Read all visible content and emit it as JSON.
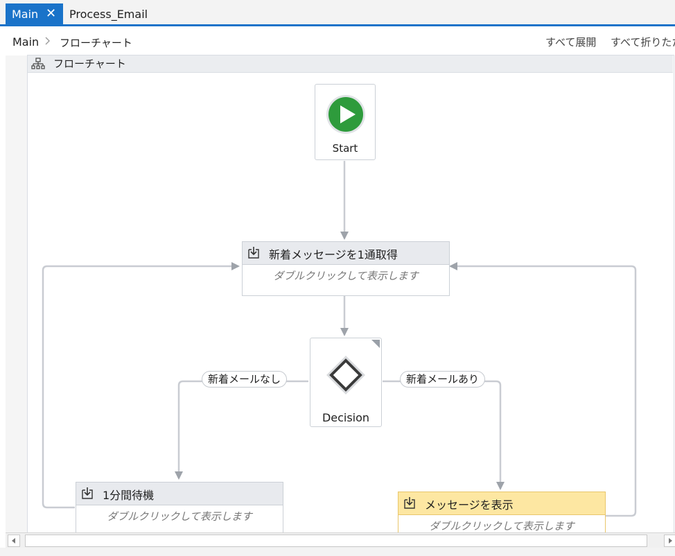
{
  "tabs": [
    {
      "label": "Main",
      "active": true,
      "close_glyph": "✕"
    },
    {
      "label": "Process_Email",
      "active": false
    }
  ],
  "breadcrumb": {
    "root": "Main",
    "current": "フローチャート"
  },
  "toolbar": {
    "expand_all": "すべて展開",
    "collapse_all": "すべて折りたた"
  },
  "flowchart": {
    "title": "フローチャート",
    "icon": "flowchart-icon",
    "start": {
      "label": "Start",
      "icon": "play-icon"
    },
    "activities": [
      {
        "id": "get-message",
        "title": "新着メッセージを1通取得",
        "body": "ダブルクリックして表示します",
        "icon": "sequence-icon",
        "selected": false
      },
      {
        "id": "wait",
        "title": "1分間待機",
        "body": "ダブルクリックして表示します",
        "icon": "sequence-icon",
        "selected": false
      },
      {
        "id": "show-message",
        "title": "メッセージを表示",
        "body": "ダブルクリックして表示します",
        "icon": "sequence-icon",
        "selected": true
      }
    ],
    "decision": {
      "label": "Decision",
      "icon": "decision-diamond-icon",
      "false_label": "新着メールなし",
      "true_label": "新着メールあり"
    }
  },
  "colors": {
    "accent": "#1a73c9",
    "start_green": "#2e9b3c",
    "selected_header": "#fde7a2",
    "wire": "#c9ccd2"
  }
}
